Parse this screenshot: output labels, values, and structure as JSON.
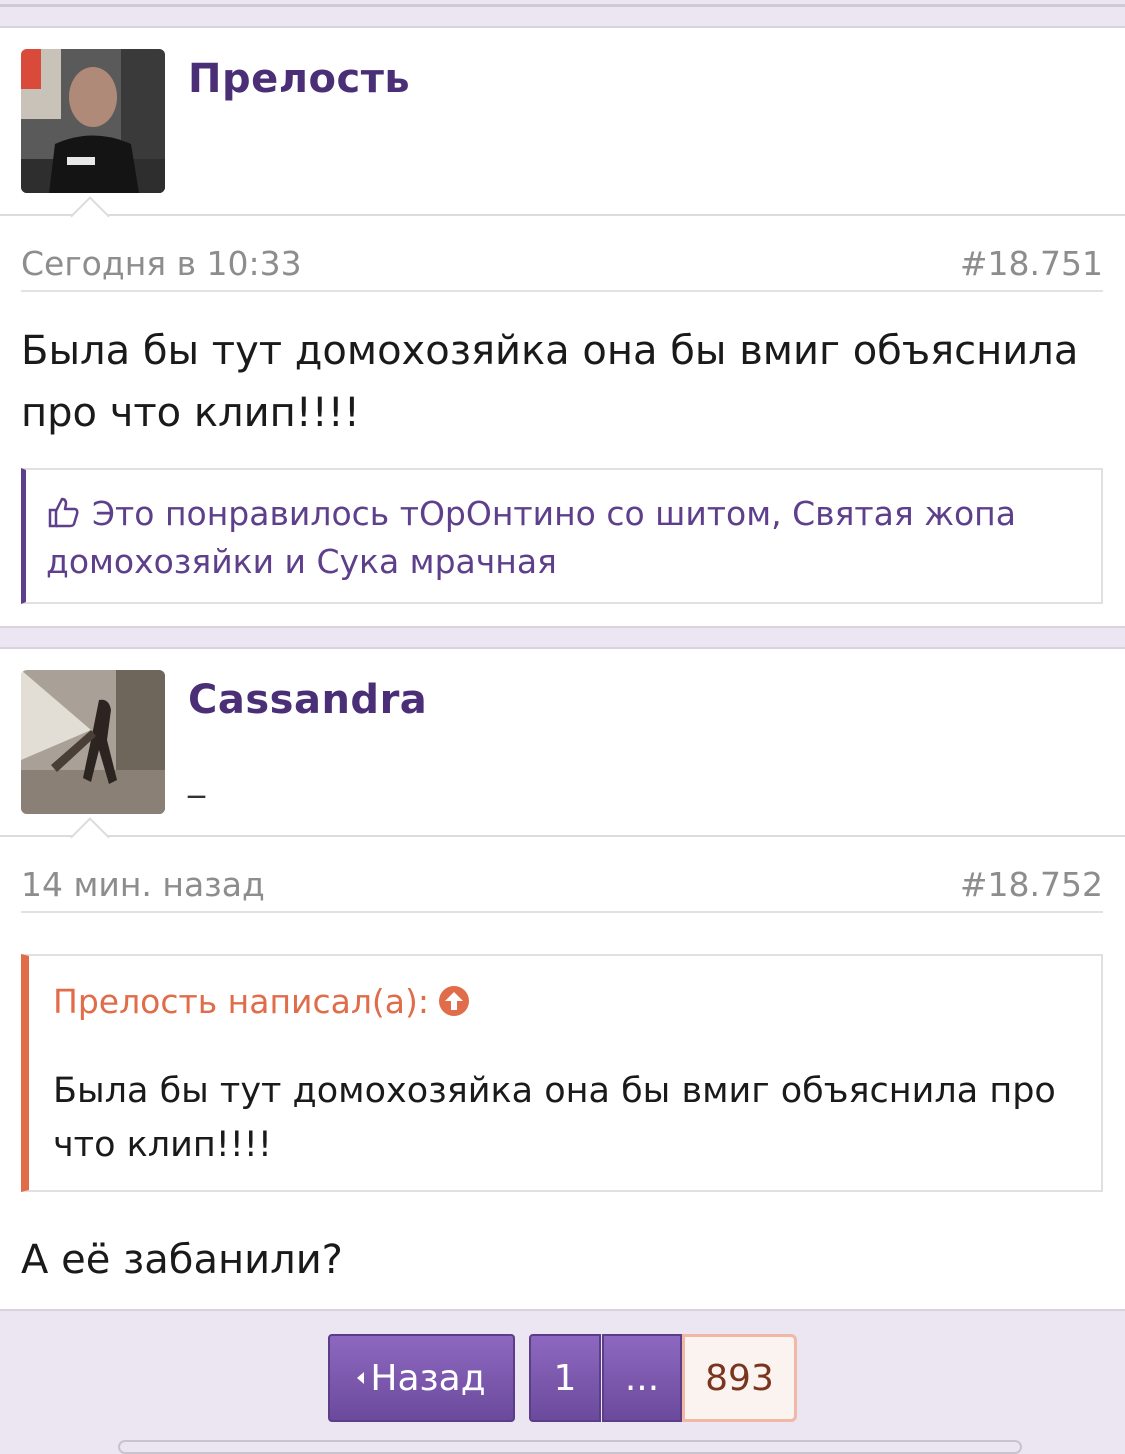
{
  "posts": [
    {
      "username": "Прелость",
      "user_title": "",
      "date": "Сегодня в 10:33",
      "number": "#18.751",
      "message": "Была бы тут домохозяйка она бы вмиг объяснила про что клип!!!!",
      "likes": "Это понравилось тОрОнтино со шитом, Святая жопа домохозяйки и Сука мрачная"
    },
    {
      "username": "Cassandra",
      "user_title": "_",
      "date": "14 мин. назад",
      "number": "#18.752",
      "quote": {
        "author": "Прелость написал(а):",
        "text": "Была бы тут домохозяйка она бы вмиг объяснила про что клип!!!!"
      },
      "message": "А её забанили?"
    }
  ],
  "pagination": {
    "back": "Назад",
    "first": "1",
    "dots": "...",
    "current": "893"
  },
  "colors": {
    "accent": "#4a2f77",
    "quote": "#e06c4a",
    "background": "#ebe6f1"
  },
  "icons": {
    "like": "thumbs-up-icon",
    "quote_jump": "arrow-up-circle-icon"
  }
}
